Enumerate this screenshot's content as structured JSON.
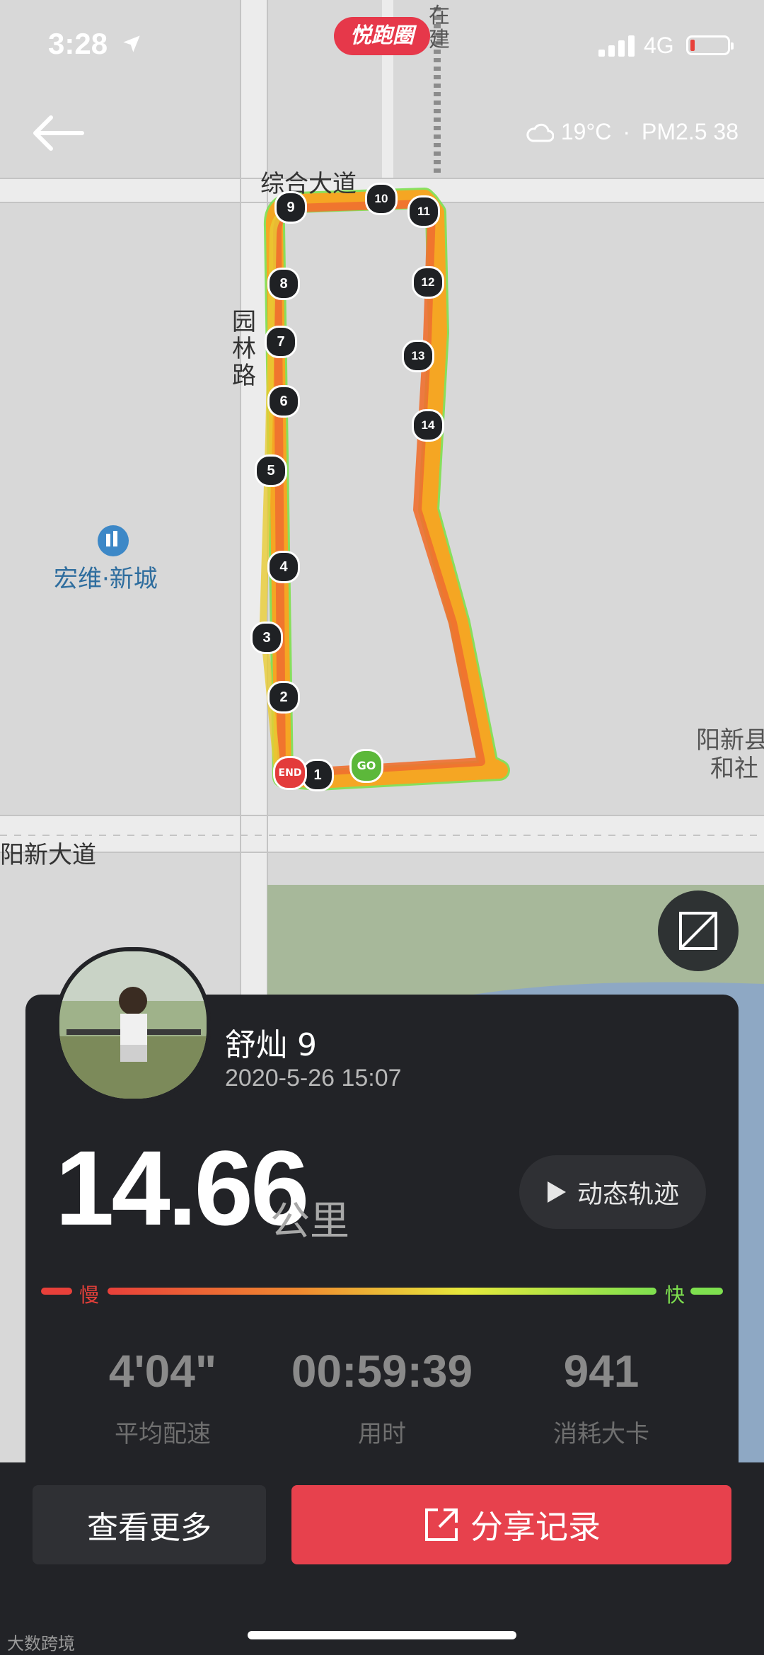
{
  "status_bar": {
    "time": "3:28",
    "network": "4G"
  },
  "app_logo": "悦跑圈",
  "weather": {
    "temperature": "19°C",
    "separator": "·",
    "air": "PM2.5 38"
  },
  "map_labels": {
    "road_top": "综合大道",
    "road_left": "园林路",
    "place_left": "宏维·新城",
    "road_bottom": "阳新大道",
    "place_right_1": "阳新县",
    "place_right_2": "和社",
    "construction": "在建"
  },
  "route": {
    "km_markers": [
      "1",
      "2",
      "3",
      "4",
      "5",
      "6",
      "7",
      "8",
      "9",
      "10",
      "11",
      "12",
      "13",
      "14"
    ],
    "start_label": "GO",
    "end_label": "END"
  },
  "runner": {
    "name": "舒灿 9",
    "datetime": "2020-5-26 15:07"
  },
  "distance": {
    "value": "14.66",
    "unit": "公里"
  },
  "replay_button": "动态轨迹",
  "pace_legend": {
    "slow": "慢",
    "fast": "快"
  },
  "stats": [
    {
      "value": "4'04\"",
      "label": "平均配速"
    },
    {
      "value": "00:59:39",
      "label": "用时"
    },
    {
      "value": "941",
      "label": "消耗大卡"
    }
  ],
  "buttons": {
    "more": "查看更多",
    "share": "分享记录"
  },
  "watermark": "大数跨境",
  "colors": {
    "accent": "#e7414d",
    "card": "#222327",
    "slow": "#e8403a",
    "fast": "#7ee04f"
  }
}
